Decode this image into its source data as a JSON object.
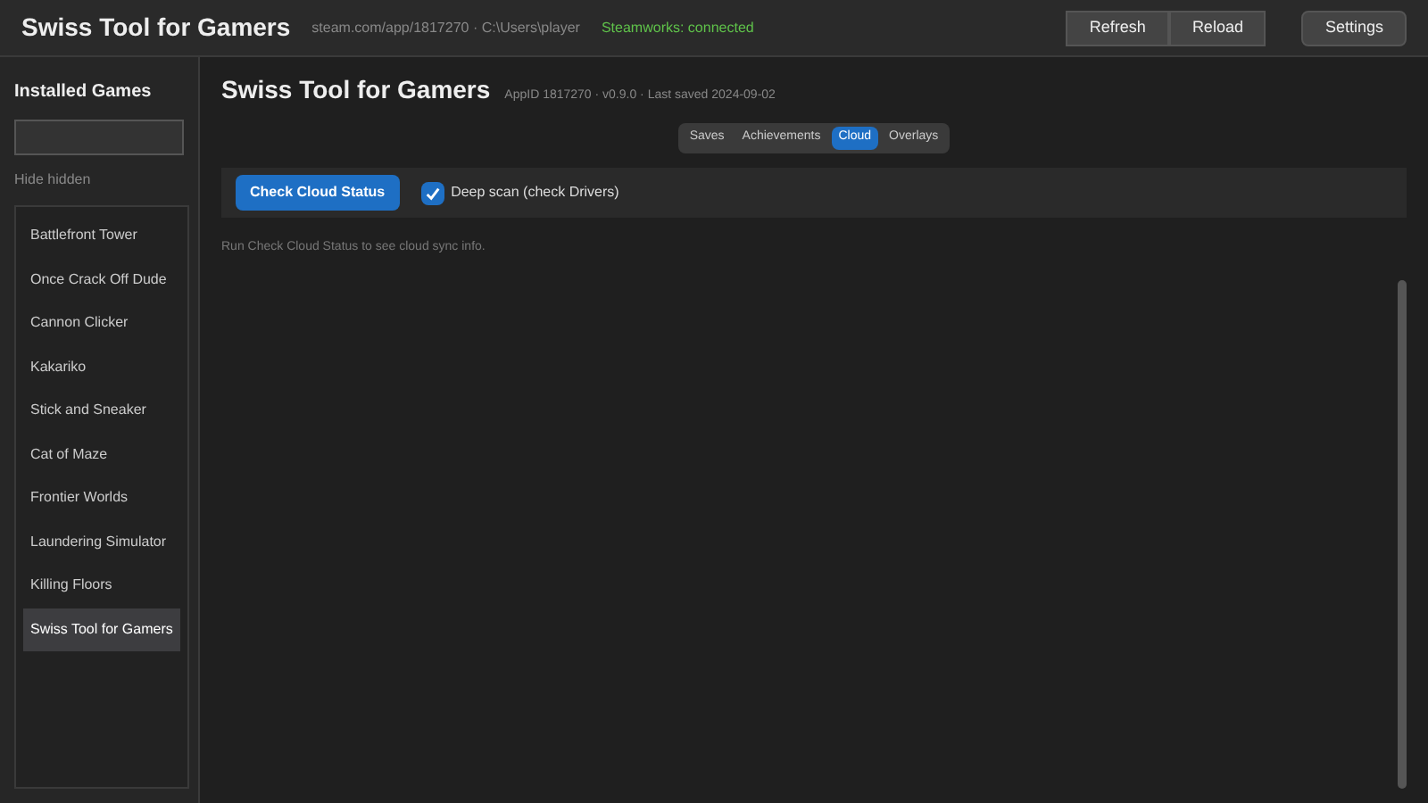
{
  "header": {
    "title": "Swiss Tool for Gamers",
    "path": "steam.com/app/1817270 · C:\\Users\\player",
    "status": "Steamworks: connected",
    "buttons": [
      "Refresh",
      "Reload",
      "Settings"
    ]
  },
  "sidebar": {
    "title": "Installed Games",
    "filter": "Hide hidden",
    "items": [
      {
        "label": "Battlefront Tower",
        "selected": false
      },
      {
        "label": "Once Crack Off Dude",
        "selected": false
      },
      {
        "label": "Cannon Clicker",
        "selected": false
      },
      {
        "label": "Kakariko",
        "selected": false
      },
      {
        "label": "Stick and Sneaker",
        "selected": false
      },
      {
        "label": "Cat of Maze",
        "selected": false
      },
      {
        "label": "Frontier Worlds",
        "selected": false
      },
      {
        "label": "Laundering Simulator",
        "selected": false
      },
      {
        "label": "Killing Floors",
        "selected": false
      },
      {
        "label": "Swiss Tool for Gamers",
        "selected": true
      }
    ]
  },
  "main": {
    "title": "Swiss Tool for Gamers",
    "meta": "AppID 1817270 · v0.9.0 · Last saved 2024-09-02",
    "tabs": [
      {
        "label": "Saves",
        "selected": false
      },
      {
        "label": "Achievements",
        "selected": false
      },
      {
        "label": "Cloud",
        "selected": true
      },
      {
        "label": "Overlays",
        "selected": false
      }
    ],
    "action": "Check Cloud Status",
    "option": {
      "label": "Deep scan (check Drivers)",
      "checked": true
    },
    "hint": "Run Check Cloud Status to see cloud sync info."
  }
}
